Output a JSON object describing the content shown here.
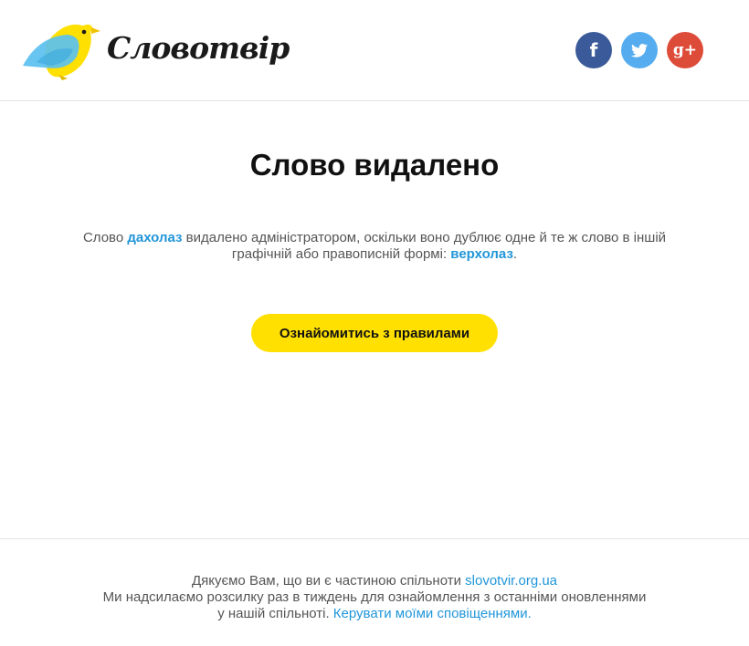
{
  "brand": {
    "name": "Словотвір"
  },
  "social": [
    {
      "name": "facebook",
      "glyph": "f",
      "color": "#3b5a99"
    },
    {
      "name": "twitter",
      "glyph": "bird",
      "color": "#55acee"
    },
    {
      "name": "google-plus",
      "glyph": "g+",
      "color": "#dd4b39"
    }
  ],
  "main": {
    "title": "Слово видалено",
    "message": {
      "prefix": "Слово ",
      "deleted_word": "дахолаз",
      "middle": " видалено адміністратором, оскільки воно дублює одне й те ж слово в іншій графічній або правописній формі: ",
      "duplicate_word": "верхолаз",
      "suffix": "."
    },
    "cta_label": "Ознайомитись з правилами"
  },
  "footer": {
    "line1_text": "Дякуємо Вам, що ви є частиною спільноти ",
    "site_link": "slovotvir.org.ua",
    "line2_text": "Ми надсилаємо розсилку раз в тиждень для ознайомлення з останніми оновленнями",
    "line3_text": "у нашій спільноті. ",
    "manage_link": "Керувати моїми сповіщеннями."
  },
  "colors": {
    "accent_yellow": "#ffe000",
    "link_blue": "#2196d9",
    "bird_blue": "#5bc0f0",
    "bird_yellow": "#ffe000"
  }
}
